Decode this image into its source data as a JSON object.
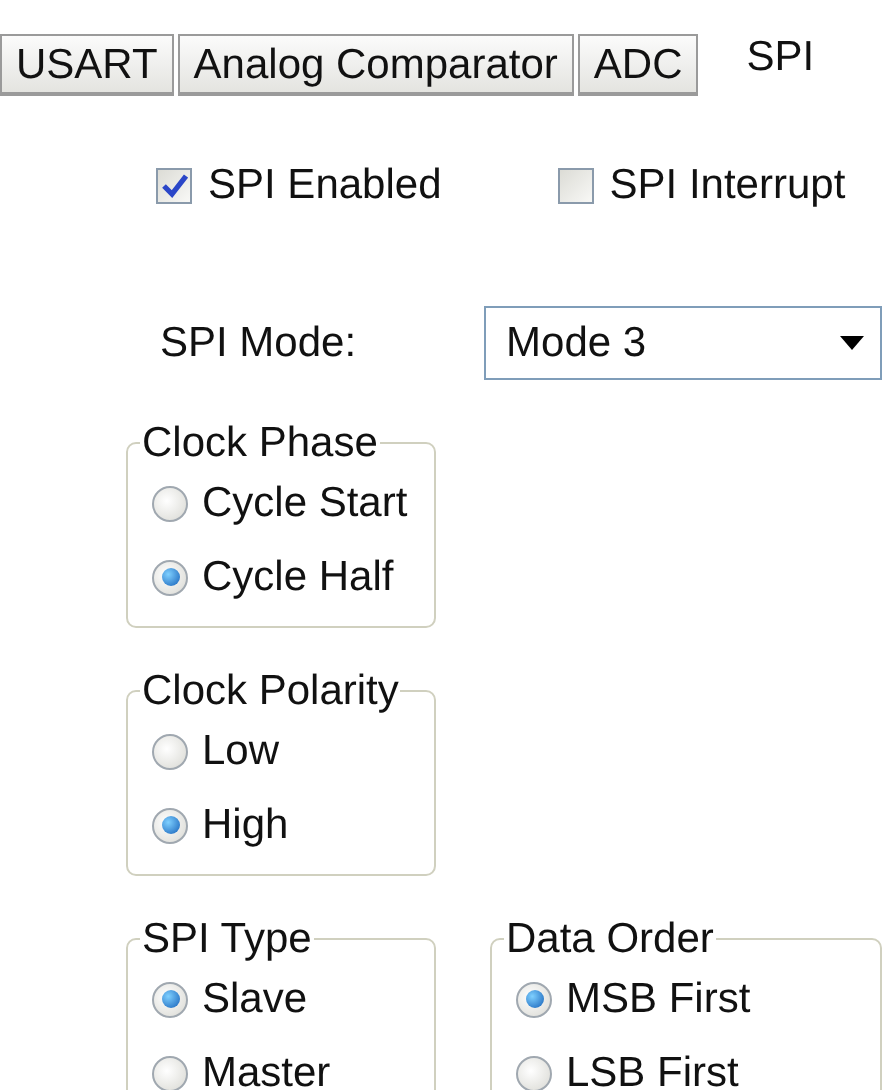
{
  "tabs": [
    {
      "label": "USART",
      "selected": false
    },
    {
      "label": "Analog Comparator",
      "selected": false
    },
    {
      "label": "ADC",
      "selected": false
    },
    {
      "label": "SPI",
      "selected": true
    }
  ],
  "checkboxes": [
    {
      "label": "SPI Enabled",
      "checked": true
    },
    {
      "label": "SPI Interrupt",
      "checked": false
    }
  ],
  "spi_mode": {
    "label": "SPI Mode:",
    "value": "Mode 3"
  },
  "groups": [
    {
      "title": "Clock Phase",
      "options": [
        {
          "label": "Cycle Start",
          "selected": false
        },
        {
          "label": "Cycle Half",
          "selected": true
        }
      ]
    },
    {
      "title": "Clock Polarity",
      "options": [
        {
          "label": "Low",
          "selected": false
        },
        {
          "label": "High",
          "selected": true
        }
      ]
    },
    {
      "title": "SPI Type",
      "options": [
        {
          "label": "Slave",
          "selected": true
        },
        {
          "label": "Master",
          "selected": false
        }
      ]
    },
    {
      "title": "Data Order",
      "options": [
        {
          "label": "MSB First",
          "selected": true
        },
        {
          "label": "LSB First",
          "selected": false
        }
      ]
    }
  ]
}
